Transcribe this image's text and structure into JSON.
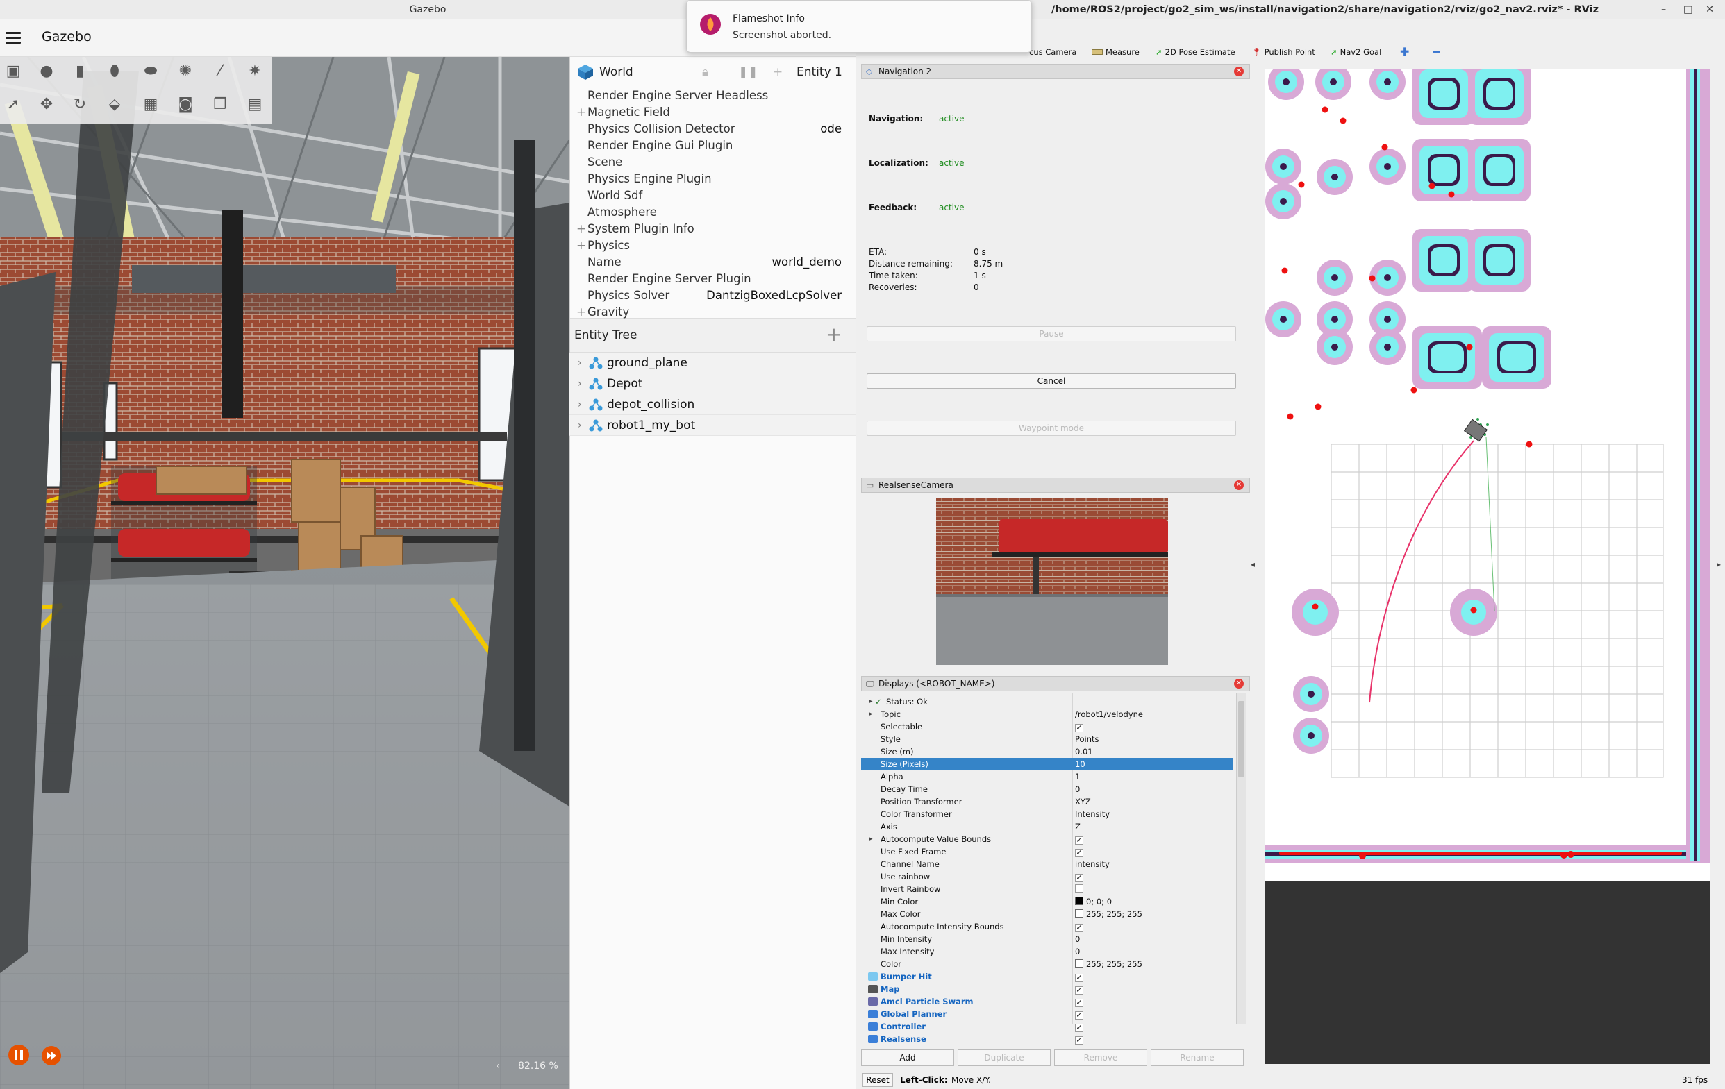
{
  "gazebo": {
    "window_title": "Gazebo",
    "app_title": "Gazebo",
    "world_label": "World",
    "entity_label": "Entity 1",
    "properties": [
      {
        "key": "Render Engine Server Headless",
        "value": "",
        "expand": ""
      },
      {
        "key": "Magnetic Field",
        "value": "",
        "expand": "+"
      },
      {
        "key": "Physics Collision Detector",
        "value": "ode",
        "expand": ""
      },
      {
        "key": "Render Engine Gui Plugin",
        "value": "",
        "expand": ""
      },
      {
        "key": "Scene",
        "value": "",
        "expand": ""
      },
      {
        "key": "Physics Engine Plugin",
        "value": "",
        "expand": ""
      },
      {
        "key": "World Sdf",
        "value": "",
        "expand": ""
      },
      {
        "key": "Atmosphere",
        "value": "",
        "expand": ""
      },
      {
        "key": "System Plugin Info",
        "value": "",
        "expand": "+"
      },
      {
        "key": "Physics",
        "value": "",
        "expand": "+"
      },
      {
        "key": "Name",
        "value": "world_demo",
        "expand": ""
      },
      {
        "key": "Render Engine Server Plugin",
        "value": "",
        "expand": ""
      },
      {
        "key": "Physics Solver",
        "value": "DantzigBoxedLcpSolver",
        "expand": ""
      },
      {
        "key": "Gravity",
        "value": "",
        "expand": "+"
      }
    ],
    "entity_tree_label": "Entity Tree",
    "entities": [
      "ground_plane",
      "Depot",
      "depot_collision",
      "robot1_my_bot"
    ],
    "zoom": "82.16 %"
  },
  "notification": {
    "title": "Flameshot Info",
    "message": "Screenshot aborted."
  },
  "rviz": {
    "window_title": "/home/ROS2/project/go2_sim_ws/install/navigation2/share/navigation2/rviz/go2_nav2.rviz* - RViz",
    "toolbar": [
      "cus Camera",
      "Measure",
      "2D Pose Estimate",
      "Publish Point",
      "Nav2 Goal"
    ],
    "nav_panel": {
      "title": "Navigation 2",
      "navigation_label": "Navigation:",
      "navigation_value": "active",
      "localization_label": "Localization:",
      "localization_value": "active",
      "feedback_label": "Feedback:",
      "feedback_value": "active",
      "eta_label": "ETA:",
      "eta_value": "0 s",
      "distance_label": "Distance remaining:",
      "distance_value": "8.75 m",
      "time_label": "Time taken:",
      "time_value": "1 s",
      "recoveries_label": "Recoveries:",
      "recoveries_value": "0",
      "pause": "Pause",
      "cancel": "Cancel",
      "waypoint": "Waypoint mode"
    },
    "camera_panel": {
      "title": "RealsenseCamera"
    },
    "displays": {
      "title": "Displays (<ROBOT_NAME>)",
      "rows": [
        {
          "key": "Status: Ok",
          "value": "",
          "type": "status",
          "arrow": "▸"
        },
        {
          "key": "Topic",
          "value": "/robot1/velodyne",
          "type": "text",
          "arrow": "▸"
        },
        {
          "key": "Selectable",
          "value": "✓",
          "type": "check",
          "arrow": ""
        },
        {
          "key": "Style",
          "value": "Points",
          "type": "text",
          "arrow": ""
        },
        {
          "key": "Size (m)",
          "value": "0.01",
          "type": "text",
          "arrow": ""
        },
        {
          "key": "Size (Pixels)",
          "value": "10",
          "type": "selected",
          "arrow": ""
        },
        {
          "key": "Alpha",
          "value": "1",
          "type": "text",
          "arrow": ""
        },
        {
          "key": "Decay Time",
          "value": "0",
          "type": "text",
          "arrow": ""
        },
        {
          "key": "Position Transformer",
          "value": "XYZ",
          "type": "text",
          "arrow": ""
        },
        {
          "key": "Color Transformer",
          "value": "Intensity",
          "type": "text",
          "arrow": ""
        },
        {
          "key": "Axis",
          "value": "Z",
          "type": "text",
          "arrow": ""
        },
        {
          "key": "Autocompute Value Bounds",
          "value": "✓",
          "type": "check",
          "arrow": "▸"
        },
        {
          "key": "Use Fixed Frame",
          "value": "✓",
          "type": "check",
          "arrow": ""
        },
        {
          "key": "Channel Name",
          "value": "intensity",
          "type": "text",
          "arrow": ""
        },
        {
          "key": "Use rainbow",
          "value": "✓",
          "type": "check",
          "arrow": ""
        },
        {
          "key": "Invert Rainbow",
          "value": "",
          "type": "check",
          "arrow": ""
        },
        {
          "key": "Min Color",
          "value": "0; 0; 0",
          "type": "color",
          "swatch": "#000000",
          "arrow": ""
        },
        {
          "key": "Max Color",
          "value": "255; 255; 255",
          "type": "color",
          "swatch": "#ffffff",
          "arrow": ""
        },
        {
          "key": "Autocompute Intensity Bounds",
          "value": "✓",
          "type": "check",
          "arrow": ""
        },
        {
          "key": "Min Intensity",
          "value": "0",
          "type": "text",
          "arrow": ""
        },
        {
          "key": "Max Intensity",
          "value": "0",
          "type": "text",
          "arrow": ""
        },
        {
          "key": "Color",
          "value": "255; 255; 255",
          "type": "color",
          "swatch": "#ffffff",
          "arrow": ""
        },
        {
          "key": "Bumper Hit",
          "value": "✓",
          "type": "group",
          "icon": "#7cc8f0",
          "arrow": ""
        },
        {
          "key": "Map",
          "value": "✓",
          "type": "group",
          "icon": "#555555",
          "arrow": ""
        },
        {
          "key": "Amcl Particle Swarm",
          "value": "✓",
          "type": "group",
          "icon": "#6a6aa8",
          "arrow": ""
        },
        {
          "key": "Global Planner",
          "value": "✓",
          "type": "group",
          "icon": "#3b7fd8",
          "arrow": ""
        },
        {
          "key": "Controller",
          "value": "✓",
          "type": "group",
          "icon": "#3b7fd8",
          "arrow": ""
        },
        {
          "key": "Realsense",
          "value": "✓",
          "type": "group",
          "icon": "#3b7fd8",
          "arrow": ""
        }
      ]
    },
    "buttons": {
      "add": "Add",
      "duplicate": "Duplicate",
      "remove": "Remove",
      "rename": "Rename",
      "reset": "Reset"
    },
    "status_hint": "Left-Click:",
    "status_hint_rest": "Move X/Y.",
    "fps": "31 fps"
  },
  "colors": {
    "accent_orange": "#e65100",
    "selection_blue": "#3584c8",
    "active_green": "#1e8c1e",
    "costmap_pink": "#d8a9d6",
    "costmap_cyan": "#7ff0f0",
    "obstacle_red": "#ee1111"
  }
}
